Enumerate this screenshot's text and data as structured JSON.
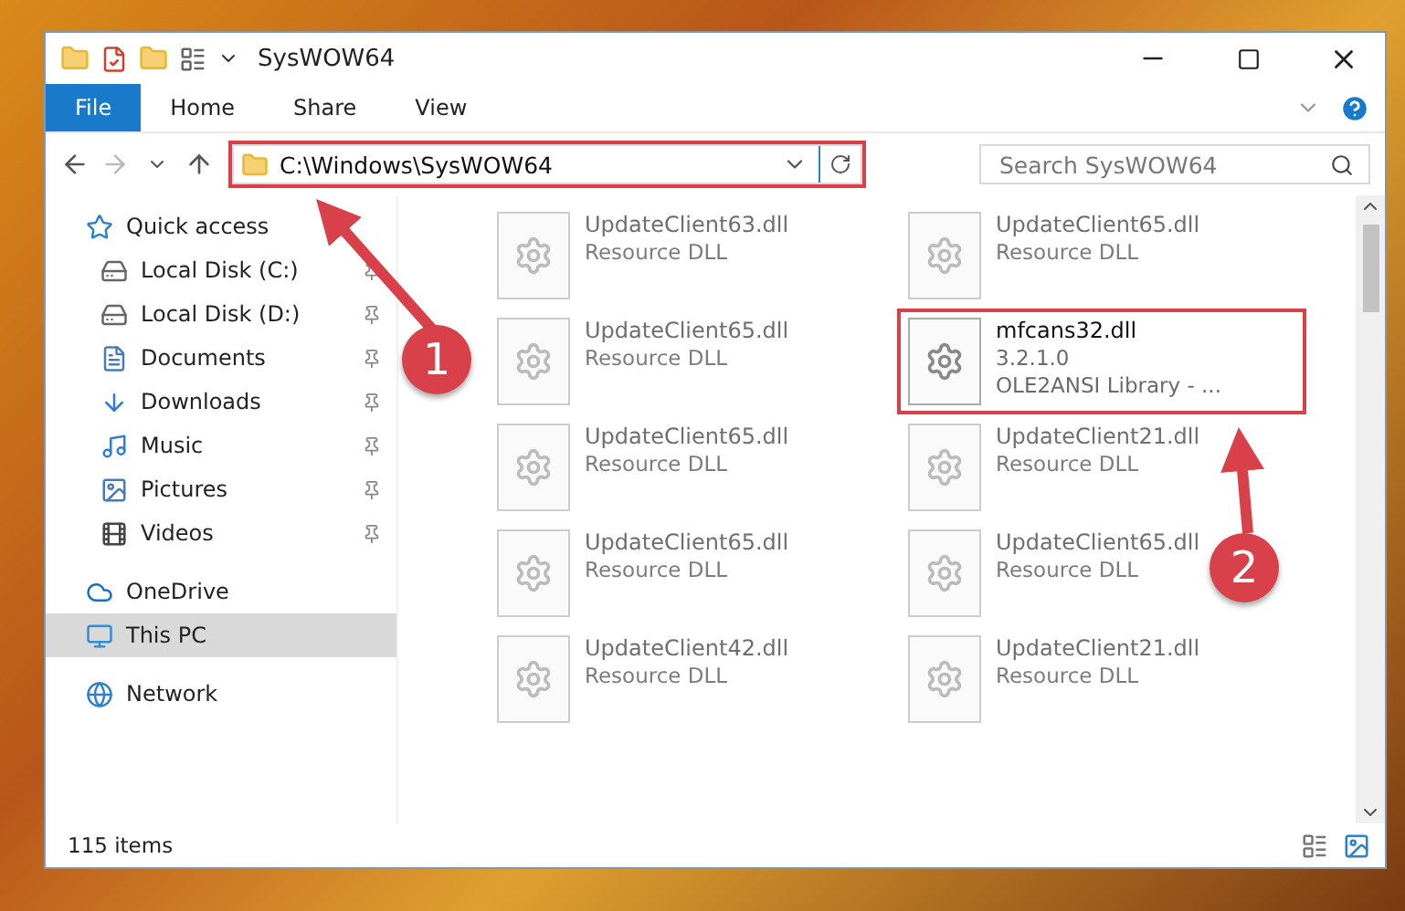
{
  "window": {
    "title": "SysWOW64"
  },
  "ribbon_tabs": [
    {
      "label": "File",
      "kind": "file"
    },
    {
      "label": "Home",
      "kind": "tab"
    },
    {
      "label": "Share",
      "kind": "tab"
    },
    {
      "label": "View",
      "kind": "tab"
    }
  ],
  "address_bar": {
    "path": "C:\\Windows\\SysWOW64",
    "highlighted": true
  },
  "search": {
    "placeholder": "Search SysWOW64"
  },
  "sidebar": {
    "items": [
      {
        "label": "Quick access",
        "selected": false,
        "children": [
          {
            "label": "Local Disk (C:)",
            "pinned": true,
            "selected": false
          },
          {
            "label": "Local Disk (D:)",
            "pinned": true,
            "selected": false
          },
          {
            "label": "Documents",
            "pinned": true,
            "selected": false
          },
          {
            "label": "Downloads",
            "pinned": true,
            "selected": false
          },
          {
            "label": "Music",
            "pinned": true,
            "selected": false
          },
          {
            "label": "Pictures",
            "pinned": true,
            "selected": false
          },
          {
            "label": "Videos",
            "pinned": true,
            "selected": false
          }
        ]
      },
      {
        "label": "OneDrive",
        "selected": false
      },
      {
        "label": "This PC",
        "selected": true
      },
      {
        "label": "Network",
        "selected": false
      }
    ]
  },
  "files": [
    {
      "name": "UpdateClient63.dll",
      "lines": [
        "Resource DLL"
      ],
      "highlighted": false,
      "blurred": true
    },
    {
      "name": "UpdateClient65.dll",
      "lines": [
        "Resource DLL"
      ],
      "highlighted": false,
      "blurred": true
    },
    {
      "name": "UpdateClient65.dll",
      "lines": [
        "Resource DLL"
      ],
      "highlighted": false,
      "blurred": true
    },
    {
      "name": "mfcans32.dll",
      "lines": [
        "3.2.1.0",
        "OLE2ANSI Library - ..."
      ],
      "highlighted": true,
      "blurred": false
    },
    {
      "name": "UpdateClient65.dll",
      "lines": [
        "Resource DLL"
      ],
      "highlighted": false,
      "blurred": true
    },
    {
      "name": "UpdateClient21.dll",
      "lines": [
        "Resource DLL"
      ],
      "highlighted": false,
      "blurred": true
    },
    {
      "name": "UpdateClient65.dll",
      "lines": [
        "Resource DLL"
      ],
      "highlighted": false,
      "blurred": true
    },
    {
      "name": "UpdateClient65.dll",
      "lines": [
        "Resource DLL"
      ],
      "highlighted": false,
      "blurred": true
    },
    {
      "name": "UpdateClient42.dll",
      "lines": [
        "Resource DLL"
      ],
      "highlighted": false,
      "blurred": true
    },
    {
      "name": "UpdateClient21.dll",
      "lines": [
        "Resource DLL"
      ],
      "highlighted": false,
      "blurred": true
    }
  ],
  "status_bar": {
    "item_count": "115 items"
  },
  "annotations": [
    {
      "number": "1"
    },
    {
      "number": "2"
    }
  ]
}
